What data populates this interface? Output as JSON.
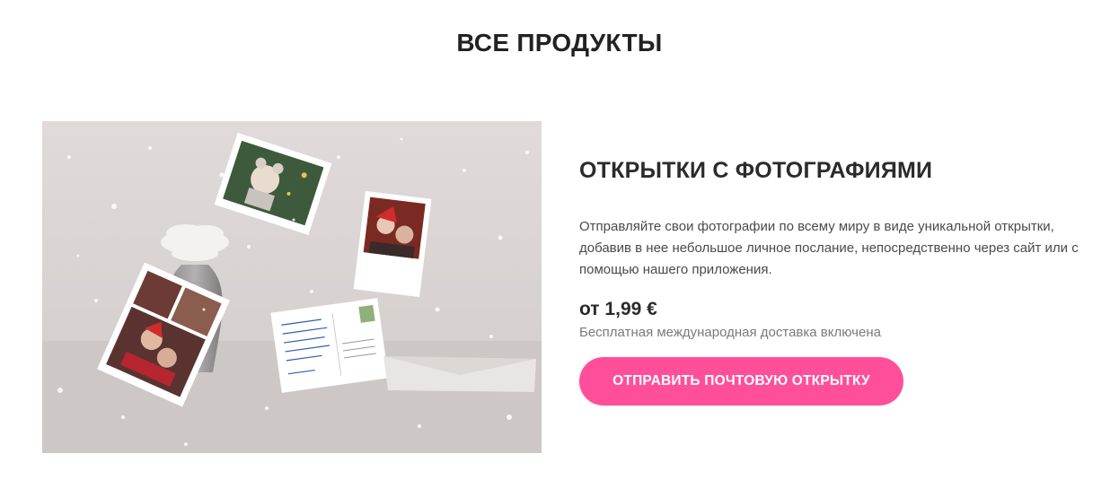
{
  "page": {
    "section_title": "ВСЕ ПРОДУКТЫ"
  },
  "product": {
    "title": "ОТКРЫТКИ С ФОТОГРАФИЯМИ",
    "description": "Отправляйте свои фотографии по всему миру в виде уникальной открытки, добавив в нее небольшое личное послание, непосредственно через сайт или с помощью нашего приложения.",
    "price": "от 1,99 €",
    "shipping": "Бесплатная международная доставка включена",
    "cta_label": "ОТПРАВИТЬ ПОЧТОВУЮ ОТКРЫТКУ",
    "image_alt": "Фото-открытки с рождественскими фотографиями, ваза с цветами"
  },
  "colors": {
    "accent": "#ff4f9a",
    "title": "#2b2b2b",
    "muted": "#7a7a7a"
  }
}
